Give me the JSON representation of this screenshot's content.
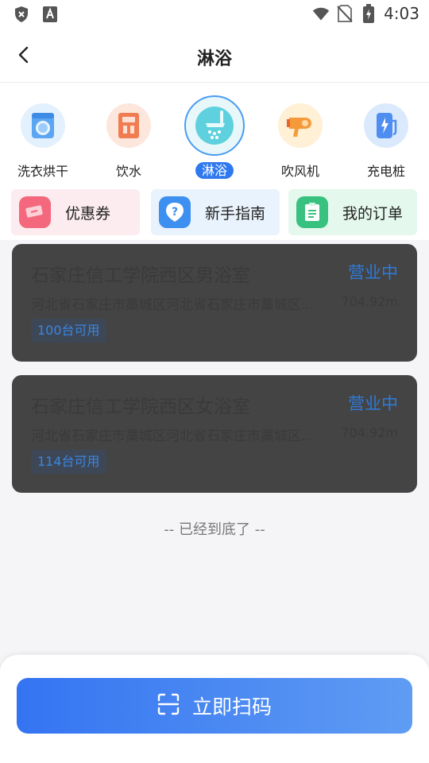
{
  "status_bar": {
    "time": "4:03",
    "icons": [
      "shield-x-icon",
      "a-letter-icon",
      "wifi-icon",
      "no-sim-icon",
      "battery-charging-icon"
    ]
  },
  "header": {
    "back_icon": "chevron-left-icon",
    "title": "淋浴"
  },
  "categories": [
    {
      "label": "洗衣烘干",
      "icon": "washing-machine-icon",
      "active": false
    },
    {
      "label": "饮水",
      "icon": "water-dispenser-icon",
      "active": false
    },
    {
      "label": "淋浴",
      "icon": "shower-icon",
      "active": true
    },
    {
      "label": "吹风机",
      "icon": "hair-dryer-icon",
      "active": false
    },
    {
      "label": "充电桩",
      "icon": "charging-station-icon",
      "active": false
    }
  ],
  "quick_actions": [
    {
      "label": "优惠券",
      "icon": "coupon-icon"
    },
    {
      "label": "新手指南",
      "icon": "guide-icon"
    },
    {
      "label": "我的订单",
      "icon": "order-list-icon"
    }
  ],
  "stores": [
    {
      "name": "石家庄信工学院西区男浴室",
      "status": "营业中",
      "address": "河北省石家庄市藁城区河北省石家庄市藁城区...",
      "distance": "704.92m",
      "available": "100台可用"
    },
    {
      "name": "石家庄信工学院西区女浴室",
      "status": "营业中",
      "address": "河北省石家庄市藁城区河北省石家庄市藁城区...",
      "distance": "704.92m",
      "available": "114台可用"
    }
  ],
  "list_end_text": "-- 已经到底了 --",
  "scan_button": {
    "label": "立即扫码",
    "icon": "scan-icon"
  },
  "colors": {
    "primary": "#2f79ee",
    "card_bg": "#444444",
    "status_text": "#2f7ad8"
  }
}
